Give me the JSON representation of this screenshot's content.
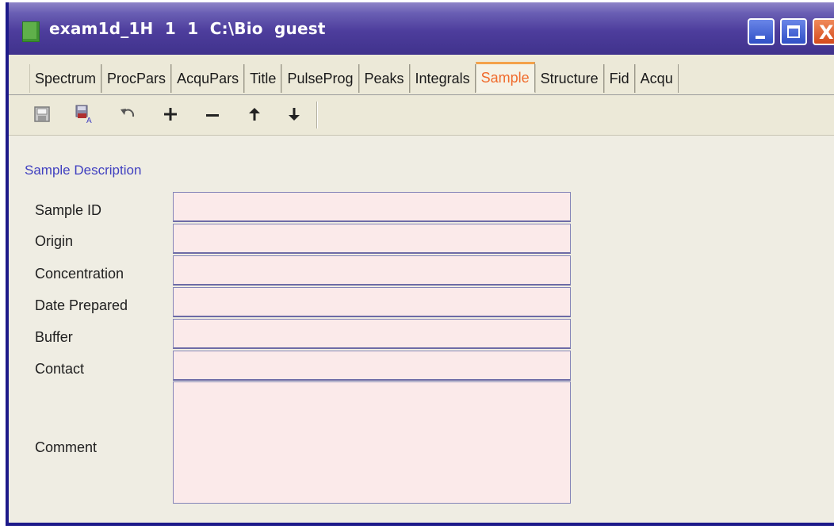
{
  "window": {
    "title": "exam1d_1H  1  1  C:\\Bio  guest",
    "close_glyph": "X"
  },
  "tabs": [
    {
      "label": "Spectrum"
    },
    {
      "label": "ProcPars"
    },
    {
      "label": "AcquPars"
    },
    {
      "label": "Title"
    },
    {
      "label": "PulseProg"
    },
    {
      "label": "Peaks"
    },
    {
      "label": "Integrals"
    },
    {
      "label": "Sample",
      "active": true
    },
    {
      "label": "Structure"
    },
    {
      "label": "Fid"
    },
    {
      "label": "Acqu"
    }
  ],
  "toolbar": {
    "icons": [
      "save-icon",
      "save-as-icon",
      "undo-icon",
      "add-icon",
      "remove-icon",
      "move-up-icon",
      "move-down-icon"
    ],
    "plus_glyph": "+",
    "minus_glyph": "−",
    "up_glyph": "↑",
    "down_glyph": "↓"
  },
  "sample": {
    "section_title": "Sample Description",
    "fields": [
      {
        "label": "Sample ID",
        "value": ""
      },
      {
        "label": "Origin",
        "value": ""
      },
      {
        "label": "Concentration",
        "value": ""
      },
      {
        "label": "Date Prepared",
        "value": ""
      },
      {
        "label": "Buffer",
        "value": ""
      },
      {
        "label": "Contact",
        "value": ""
      }
    ],
    "comment_label": "Comment",
    "comment_value": ""
  },
  "colors": {
    "titlebar": "#4d3d9c",
    "active_tab_text": "#f06b2c",
    "section_title": "#4040c0",
    "field_background": "#fbeaea"
  }
}
